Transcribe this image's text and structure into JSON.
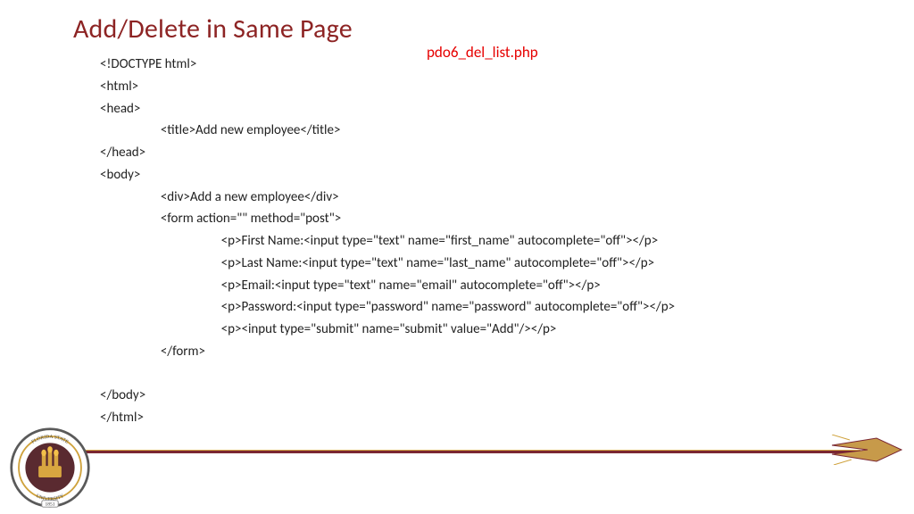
{
  "title": "Add/Delete in Same Page",
  "filename": "pdo6_del_list.php",
  "code_lines": [
    "<!DOCTYPE html>",
    "<html>",
    "<head>",
    "\t\t<title>Add new employee</title>",
    "</head>",
    "<body>",
    "\t\t<div>Add a new employee</div>",
    "\t\t<form action=\"\" method=\"post\">",
    "\t\t\t\t<p>First Name:<input type=\"text\" name=\"first_name\" autocomplete=\"off\"></p>",
    "\t\t\t\t<p>Last Name:<input type=\"text\" name=\"last_name\" autocomplete=\"off\"></p>",
    "\t\t\t\t<p>Email:<input type=\"text\" name=\"email\" autocomplete=\"off\"></p>",
    "\t\t\t\t<p>Password:<input type=\"password\" name=\"password\" autocomplete=\"off\"></p>",
    "\t\t\t\t<p><input type=\"submit\" name=\"submit\" value=\"Add\"/></p>",
    "\t\t</form>",
    "",
    "</body>",
    "</html>"
  ],
  "seal": {
    "text_top": "FLORIDA STATE",
    "text_bottom": "UNIVERSITY",
    "year": "1851"
  }
}
